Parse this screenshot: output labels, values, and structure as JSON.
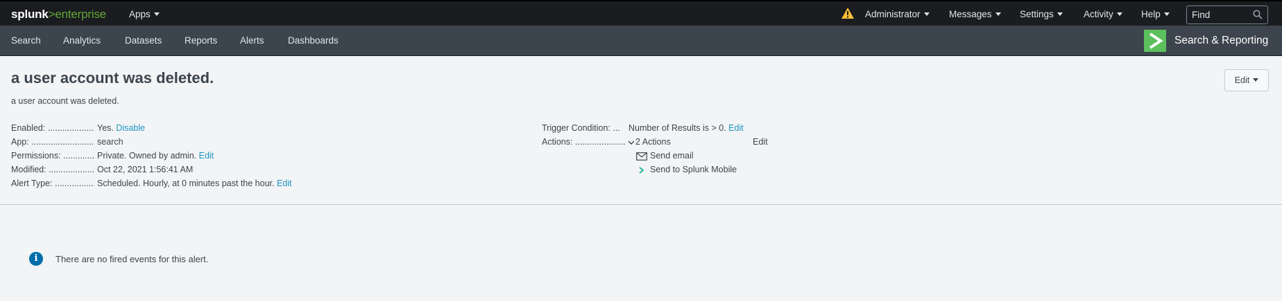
{
  "topbar": {
    "logo_main": "splunk",
    "logo_gt": ">",
    "logo_suffix": "enterprise",
    "apps_label": "Apps",
    "user_label": "Administrator",
    "messages_label": "Messages",
    "settings_label": "Settings",
    "activity_label": "Activity",
    "help_label": "Help",
    "find_placeholder": "Find"
  },
  "appbar": {
    "nav": [
      "Search",
      "Analytics",
      "Datasets",
      "Reports",
      "Alerts",
      "Dashboards"
    ],
    "app_name": "Search & Reporting"
  },
  "alert": {
    "title": "a user account was deleted.",
    "description": "a user account was deleted.",
    "edit_label": "Edit",
    "fields": {
      "enabled_label": "Enabled: ......................",
      "enabled_value": "Yes.",
      "enabled_link": "Disable",
      "app_label": "App: .......................................",
      "app_value": "search",
      "permissions_label": "Permissions: ..............",
      "permissions_value": "Private. Owned by admin.",
      "permissions_link": "Edit",
      "modified_label": "Modified: ......................",
      "modified_value": "Oct 22, 2021 1:56:41 AM",
      "alert_type_label": "Alert Type: ...................",
      "alert_type_value": "Scheduled. Hourly, at 0 minutes past the hour.",
      "alert_type_link": "Edit",
      "trigger_label": "Trigger Condition: ...",
      "trigger_value": "Number of Results is > 0.",
      "trigger_link": "Edit",
      "actions_label": "Actions: ..........................",
      "actions_value": "2 Actions",
      "actions_link": "Edit",
      "action_items": [
        "Send email",
        "Send to Splunk Mobile"
      ]
    }
  },
  "fired_events": {
    "message": "There are no fired events for this alert."
  },
  "colors": {
    "topbar_bg": "#1a1c20",
    "appbar_bg": "#3c444d",
    "link": "#1e93c6",
    "brand_green": "#65a637",
    "app_icon_green": "#5cc05c",
    "warning": "#f8be34",
    "info": "#006eaa"
  }
}
